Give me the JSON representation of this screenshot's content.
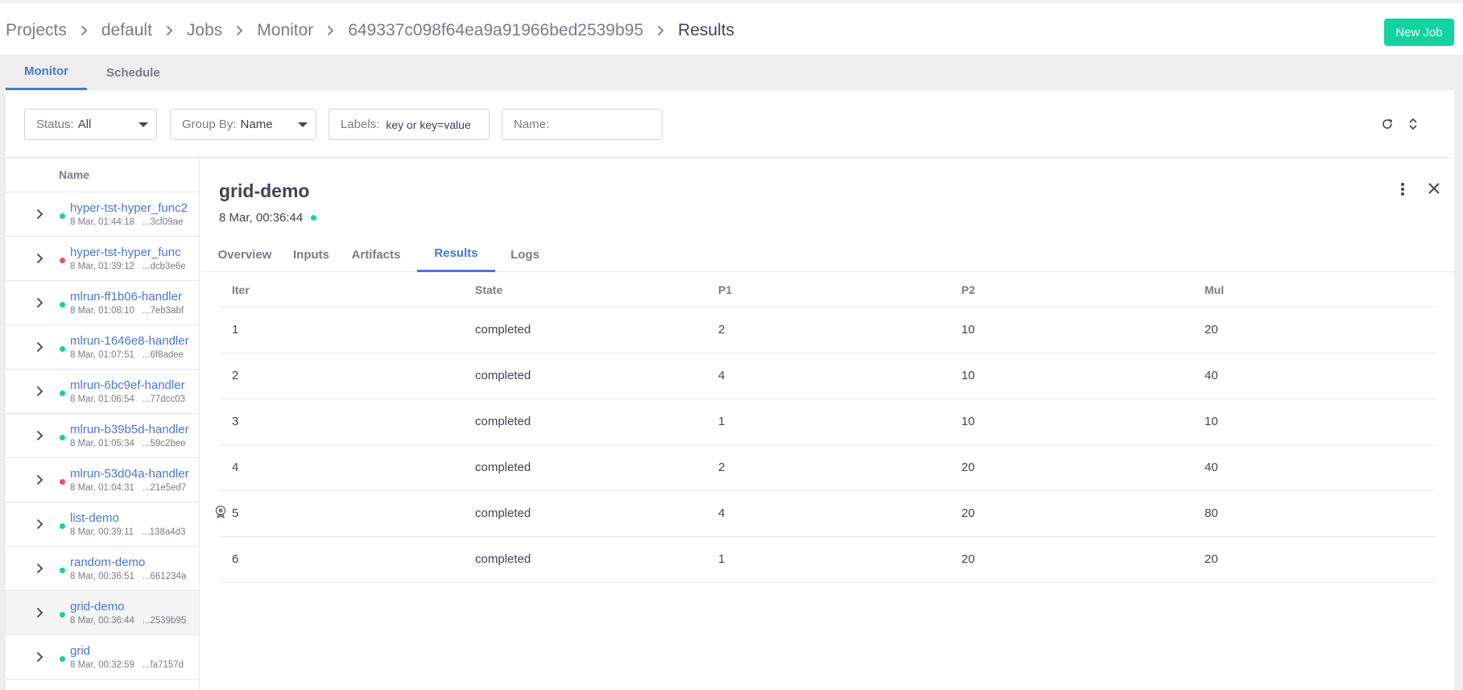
{
  "breadcrumb": {
    "items": [
      "Projects",
      "default",
      "Jobs",
      "Monitor",
      "649337c098f64ea9a91966bed2539b95",
      "Results"
    ]
  },
  "header": {
    "new_job_label": "New Job"
  },
  "top_tabs": {
    "monitor": "Monitor",
    "schedule": "Schedule"
  },
  "filters": {
    "status_label": "Status:",
    "status_value": "All",
    "group_label": "Group By:",
    "group_value": "Name",
    "labels_label": "Labels:",
    "labels_placeholder": "key or key=value",
    "name_label": "Name:"
  },
  "sidebar": {
    "header": "Name",
    "items": [
      {
        "name": "hyper-tst-hyper_func2",
        "date": "8 Mar, 01:44:18",
        "uid": "...3cf09ae",
        "status": "completed"
      },
      {
        "name": "hyper-tst-hyper_func",
        "date": "8 Mar, 01:39:12",
        "uid": "...dcb3e6e",
        "status": "error"
      },
      {
        "name": "mlrun-ff1b06-handler",
        "date": "8 Mar, 01:08:10",
        "uid": "...7eb3abf",
        "status": "completed"
      },
      {
        "name": "mlrun-1646e8-handler",
        "date": "8 Mar, 01:07:51",
        "uid": "...6f8adee",
        "status": "completed"
      },
      {
        "name": "mlrun-6bc9ef-handler",
        "date": "8 Mar, 01:06:54",
        "uid": "...77dcc03",
        "status": "completed"
      },
      {
        "name": "mlrun-b39b5d-handler",
        "date": "8 Mar, 01:05:34",
        "uid": "...59c2bee",
        "status": "completed"
      },
      {
        "name": "mlrun-53d04a-handler",
        "date": "8 Mar, 01:04:31",
        "uid": "...21e5ed7",
        "status": "error"
      },
      {
        "name": "list-demo",
        "date": "8 Mar, 00:39:11",
        "uid": "...138a4d3",
        "status": "completed"
      },
      {
        "name": "random-demo",
        "date": "8 Mar, 00:36:51",
        "uid": "...661234a",
        "status": "completed"
      },
      {
        "name": "grid-demo",
        "date": "8 Mar, 00:36:44",
        "uid": "...2539b95",
        "status": "completed",
        "selected": true
      },
      {
        "name": "grid",
        "date": "8 Mar, 00:32:59",
        "uid": "...fa7157d",
        "status": "completed"
      }
    ]
  },
  "details": {
    "title": "grid-demo",
    "date": "8 Mar, 00:36:44",
    "tabs": [
      "Overview",
      "Inputs",
      "Artifacts",
      "Results",
      "Logs"
    ],
    "active_tab": "Results"
  },
  "results": {
    "columns": [
      "Iter",
      "State",
      "P1",
      "P2",
      "Mul"
    ],
    "rows": [
      {
        "iter": "1",
        "state": "completed",
        "p1": "2",
        "p2": "10",
        "mul": "20",
        "best": false
      },
      {
        "iter": "2",
        "state": "completed",
        "p1": "4",
        "p2": "10",
        "mul": "40",
        "best": false
      },
      {
        "iter": "3",
        "state": "completed",
        "p1": "1",
        "p2": "10",
        "mul": "10",
        "best": false
      },
      {
        "iter": "4",
        "state": "completed",
        "p1": "2",
        "p2": "20",
        "mul": "40",
        "best": false
      },
      {
        "iter": "5",
        "state": "completed",
        "p1": "4",
        "p2": "20",
        "mul": "80",
        "best": true
      },
      {
        "iter": "6",
        "state": "completed",
        "p1": "1",
        "p2": "20",
        "mul": "20",
        "best": false
      }
    ]
  },
  "colors": {
    "accent": "#4b75d7",
    "success": "#13d3a0",
    "error": "#eb5454"
  }
}
